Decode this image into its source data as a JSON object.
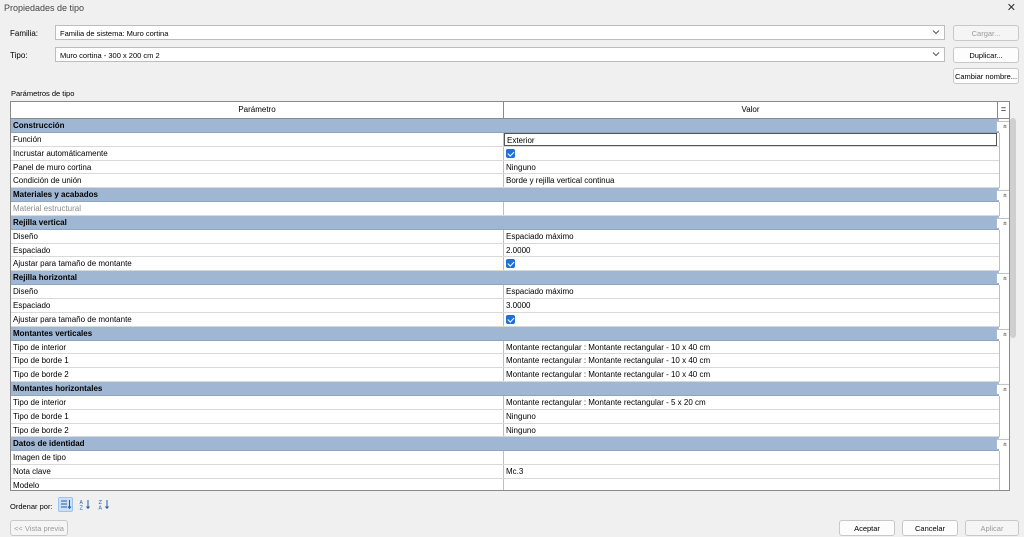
{
  "window": {
    "title": "Propiedades de tipo",
    "close_glyph": "✕"
  },
  "familia": {
    "label": "Familia:",
    "value": "Familia de sistema: Muro cortina"
  },
  "tipo": {
    "label": "Tipo:",
    "value": "Muro cortina - 300 x 200 cm 2"
  },
  "buttons": {
    "cargar": "Cargar...",
    "duplicar": "Duplicar...",
    "cambiar_nombre": "Cambiar nombre...",
    "vista_previa": "<< Vista previa",
    "aceptar": "Aceptar",
    "cancelar": "Cancelar",
    "aplicar": "Aplicar"
  },
  "params_label": "Parámetros de tipo",
  "grid": {
    "col_param": "Parámetro",
    "col_valor": "Valor",
    "col_extra": "=",
    "collapse_glyph": "«"
  },
  "rows": [
    {
      "group": "Construcción"
    },
    {
      "param": "Función",
      "value": "Exterior",
      "edit": true
    },
    {
      "param": "Incrustar automáticamente",
      "check": true
    },
    {
      "param": "Panel de muro cortina",
      "value": "Ninguno"
    },
    {
      "param": "Condición de unión",
      "value": "Borde y rejilla vertical continua"
    },
    {
      "group": "Materiales y acabados"
    },
    {
      "param": "Material estructural",
      "value": "",
      "disabled": true
    },
    {
      "group": "Rejilla vertical"
    },
    {
      "param": "Diseño",
      "value": "Espaciado máximo"
    },
    {
      "param": "Espaciado",
      "value": "2.0000"
    },
    {
      "param": "Ajustar para tamaño de montante",
      "check": true
    },
    {
      "group": "Rejilla horizontal"
    },
    {
      "param": "Diseño",
      "value": "Espaciado máximo"
    },
    {
      "param": "Espaciado",
      "value": "3.0000"
    },
    {
      "param": "Ajustar para tamaño de montante",
      "check": true
    },
    {
      "group": "Montantes verticales"
    },
    {
      "param": "Tipo de interior",
      "value": "Montante rectangular : Montante rectangular - 10 x 40 cm"
    },
    {
      "param": "Tipo de borde 1",
      "value": "Montante rectangular : Montante rectangular - 10 x 40 cm"
    },
    {
      "param": "Tipo de borde 2",
      "value": "Montante rectangular : Montante rectangular - 10 x 40 cm"
    },
    {
      "group": "Montantes horizontales"
    },
    {
      "param": "Tipo de interior",
      "value": "Montante rectangular : Montante rectangular - 5 x 20 cm"
    },
    {
      "param": "Tipo de borde 1",
      "value": "Ninguno"
    },
    {
      "param": "Tipo de borde 2",
      "value": "Ninguno"
    },
    {
      "group": "Datos de identidad"
    },
    {
      "param": "Imagen de tipo",
      "value": ""
    },
    {
      "param": "Nota clave",
      "value": "Mc.3"
    },
    {
      "param": "Modelo",
      "value": ""
    }
  ],
  "sort": {
    "label": "Ordenar por:"
  },
  "colors": {
    "group_bg": "#9fb7d3",
    "accent": "#1f6fd6"
  }
}
